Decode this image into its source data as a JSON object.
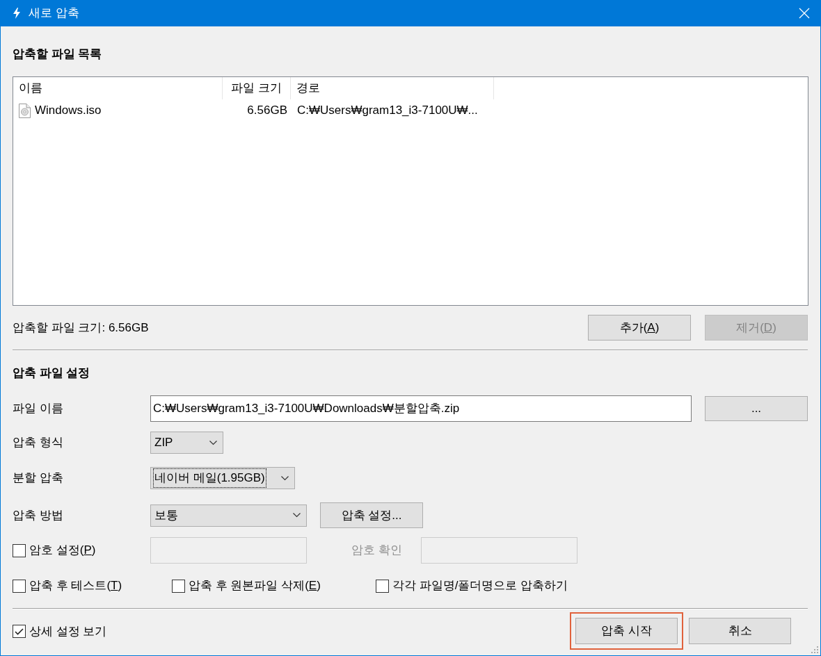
{
  "window": {
    "title": "새로 압축"
  },
  "file_list": {
    "heading": "압축할 파일 목록",
    "columns": [
      "이름",
      "파일 크기",
      "경로"
    ],
    "rows": [
      {
        "name": "Windows.iso",
        "size": "6.56GB",
        "path": "C:₩Users₩gram13_i3-7100U₩..."
      }
    ],
    "total_size": "압축할 파일 크기: 6.56GB",
    "buttons": [
      {
        "prefix": "추가(",
        "accel": "A",
        "suffix": ")",
        "disabled": false
      },
      {
        "prefix": "제거(",
        "accel": "D",
        "suffix": ")",
        "disabled": true
      }
    ]
  },
  "settings": {
    "heading": "압축 파일 설정",
    "file_name": {
      "label": "파일 이름",
      "value": "C:₩Users₩gram13_i3-7100U₩Downloads₩분할압축.zip",
      "browse": "..."
    },
    "format": {
      "label": "압축 형식",
      "value": "ZIP",
      "focused": false
    },
    "split": {
      "label": "분할 압축",
      "value": "네이버 메일(1.95GB)",
      "focused": true
    },
    "method": {
      "label": "압축 방법",
      "value": "보통",
      "focused": false,
      "button": "압축 설정..."
    },
    "password": {
      "checkbox": {
        "prefix": "암호 설정(",
        "accel": "P",
        "suffix": ")",
        "checked": false
      },
      "confirm_label": "암호 확인",
      "disabled": true
    },
    "options": [
      {
        "prefix": "압축 후 테스트(",
        "accel": "T",
        "suffix": ")",
        "checked": false
      },
      {
        "prefix": "압축 후 원본파일 삭제(",
        "accel": "E",
        "suffix": ")",
        "checked": false
      },
      {
        "prefix": "각각 파일명/폴더명으로 압축하기",
        "checked": false
      }
    ]
  },
  "footer": {
    "details": {
      "prefix": "상세 설정 보기",
      "checked": true
    },
    "buttons": [
      {
        "label": "압축 시작",
        "highlighted": true
      },
      {
        "label": "취소",
        "highlighted": false
      }
    ]
  }
}
